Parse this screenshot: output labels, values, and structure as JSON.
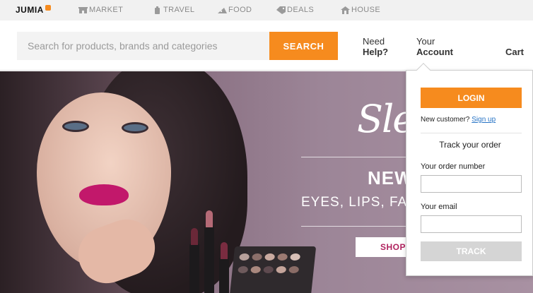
{
  "topbar": {
    "logo": "JUMIA",
    "verticals": [
      {
        "label": "MARKET",
        "icon": "market-icon"
      },
      {
        "label": "TRAVEL",
        "icon": "travel-icon"
      },
      {
        "label": "FOOD",
        "icon": "food-icon"
      },
      {
        "label": "DEALS",
        "icon": "deals-icon"
      },
      {
        "label": "HOUSE",
        "icon": "house-icon"
      }
    ]
  },
  "header": {
    "search_placeholder": "Search for products, brands and categories",
    "search_value": "",
    "search_button": "SEARCH",
    "help_line1": "Need",
    "help_line2": "Help?",
    "account_line1": "Your",
    "account_line2": "Account",
    "cart": "Cart"
  },
  "hero": {
    "brand_script": "Sle",
    "title": "NEW",
    "subtitle": "EYES, LIPS, FAC",
    "cta": "SHOP"
  },
  "account_dropdown": {
    "login_button": "LOGIN",
    "new_customer_text": "New customer?",
    "signup_link": "Sign up",
    "track_title": "Track your order",
    "order_number_label": "Your order number",
    "order_number_value": "",
    "email_label": "Your email",
    "email_value": "",
    "track_button": "TRACK"
  },
  "colors": {
    "brand_orange": "#f68b1e",
    "link_blue": "#2673c5",
    "disabled_gray": "#d5d5d5"
  }
}
